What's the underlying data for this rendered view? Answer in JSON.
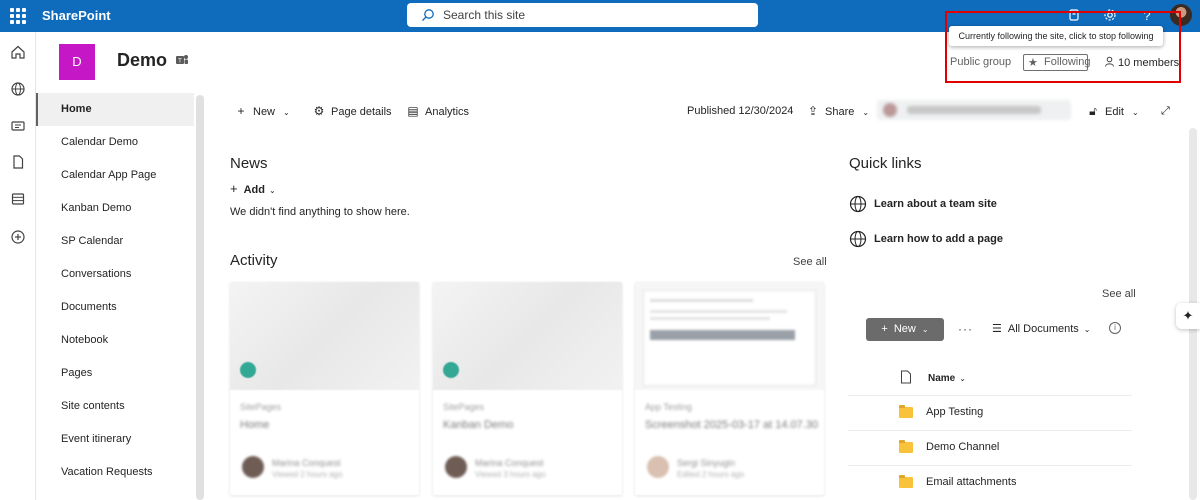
{
  "topbar": {
    "app_name": "SharePoint",
    "search_placeholder": "Search this site",
    "help_label": "?"
  },
  "site": {
    "logo_letter": "D",
    "title": "Demo",
    "tooltip": "Currently following the site, click to stop following",
    "privacy": "Public group",
    "follow_label": "Following",
    "members_label": "10 members"
  },
  "nav": {
    "items": [
      {
        "label": "Home"
      },
      {
        "label": "Calendar Demo"
      },
      {
        "label": "Calendar App Page"
      },
      {
        "label": "Kanban Demo"
      },
      {
        "label": "SP Calendar"
      },
      {
        "label": "Conversations"
      },
      {
        "label": "Documents"
      },
      {
        "label": "Notebook"
      },
      {
        "label": "Pages"
      },
      {
        "label": "Site contents"
      },
      {
        "label": "Event itinerary"
      },
      {
        "label": "Vacation Requests"
      }
    ]
  },
  "commandbar": {
    "new_label": "New",
    "page_details_label": "Page details",
    "analytics_label": "Analytics",
    "published_label": "Published 12/30/2024",
    "share_label": "Share",
    "editing_status": "Sergi Sinyugin is editing this page",
    "edit_label": "Edit"
  },
  "news": {
    "title": "News",
    "add_label": "Add",
    "empty_message": "We didn't find anything to show here."
  },
  "activity": {
    "title": "Activity",
    "see_all": "See all",
    "cards": [
      {
        "category": "SitePages",
        "title": "Home",
        "author": "Marina Conquest",
        "meta": "Viewed 2 hours ago"
      },
      {
        "category": "SitePages",
        "title": "Kanban Demo",
        "author": "Marina Conquest",
        "meta": "Viewed 3 hours ago"
      },
      {
        "category": "App Testing",
        "title": "Screenshot 2025-03-17 at 14.07.30",
        "author": "Sergi Sinyugin",
        "meta": "Edited 2 hours ago"
      }
    ]
  },
  "quick_links": {
    "title": "Quick links",
    "items": [
      {
        "label": "Learn about a team site"
      },
      {
        "label": "Learn how to add a page"
      }
    ]
  },
  "documents": {
    "see_all": "See all",
    "new_label": "New",
    "more_label": "···",
    "view_label": "All Documents",
    "column_name": "Name",
    "rows": [
      {
        "name": "App Testing"
      },
      {
        "name": "Demo Channel"
      },
      {
        "name": "Email attachments"
      }
    ]
  }
}
